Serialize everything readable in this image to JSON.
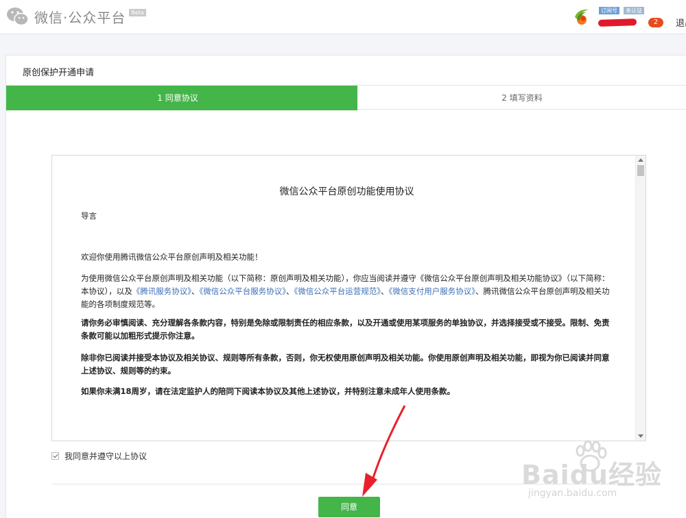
{
  "header": {
    "brand": "微信·公众平台",
    "beta": "Beta",
    "account_tag_1": "订阅号",
    "account_tag_2": "未认证",
    "account_name": "",
    "notification_count": "2",
    "logout": "退出"
  },
  "panel": {
    "title": "原创保护开通申请",
    "steps": [
      {
        "label": "1 同意协议"
      },
      {
        "label": "2 填写资料"
      }
    ]
  },
  "agreement": {
    "title": "微信公众平台原创功能使用协议",
    "intro_heading": "导言",
    "para1": "欢迎你使用腾讯微信公众平台原创声明及相关功能！",
    "para2_pre": "为使用微信公众平台原创声明及相关功能（以下简称：原创声明及相关功能），你应当阅读并遵守《微信公众平台原创声明及相关功能协议》（以下简称：本协议），以及",
    "para2_link1": "《腾讯服务协议》",
    "para2_sep1": "、",
    "para2_link2": "《微信公众平台服务协议》",
    "para2_sep2": "、",
    "para2_link3": "《微信公众平台运营规范》",
    "para2_sep3": "、",
    "para2_link4": "《微信支付用户服务协议》",
    "para2_post": "、腾讯微信公众平台原创声明及相关功能的各项制度规范等。",
    "para3": "请你务必审慎阅读、充分理解各条款内容，特别是免除或限制责任的相应条款，以及开通或使用某项服务的单独协议，并选择接受或不接受。限制、免责条款可能以加粗形式提示你注意。",
    "para4": "除非你已阅读并接受本协议及相关协议、规则等所有条款，否则，你无权使用原创声明及相关功能。你使用原创声明及相关功能，即视为你已阅读并同意上述协议、规则等的约束。",
    "para5": "如果你未满18周岁，请在法定监护人的陪同下阅读本协议及其他上述协议，并特别注意未成年人使用条款。"
  },
  "checkbox_label": "我同意并遵守以上协议",
  "agree_button": "同意",
  "watermark": {
    "big": "Baidu经验",
    "small": "jingyan.baidu.com"
  },
  "colors": {
    "accent": "#44b549",
    "link": "#3d6fb6",
    "annotation_arrow": "#e8202a"
  }
}
